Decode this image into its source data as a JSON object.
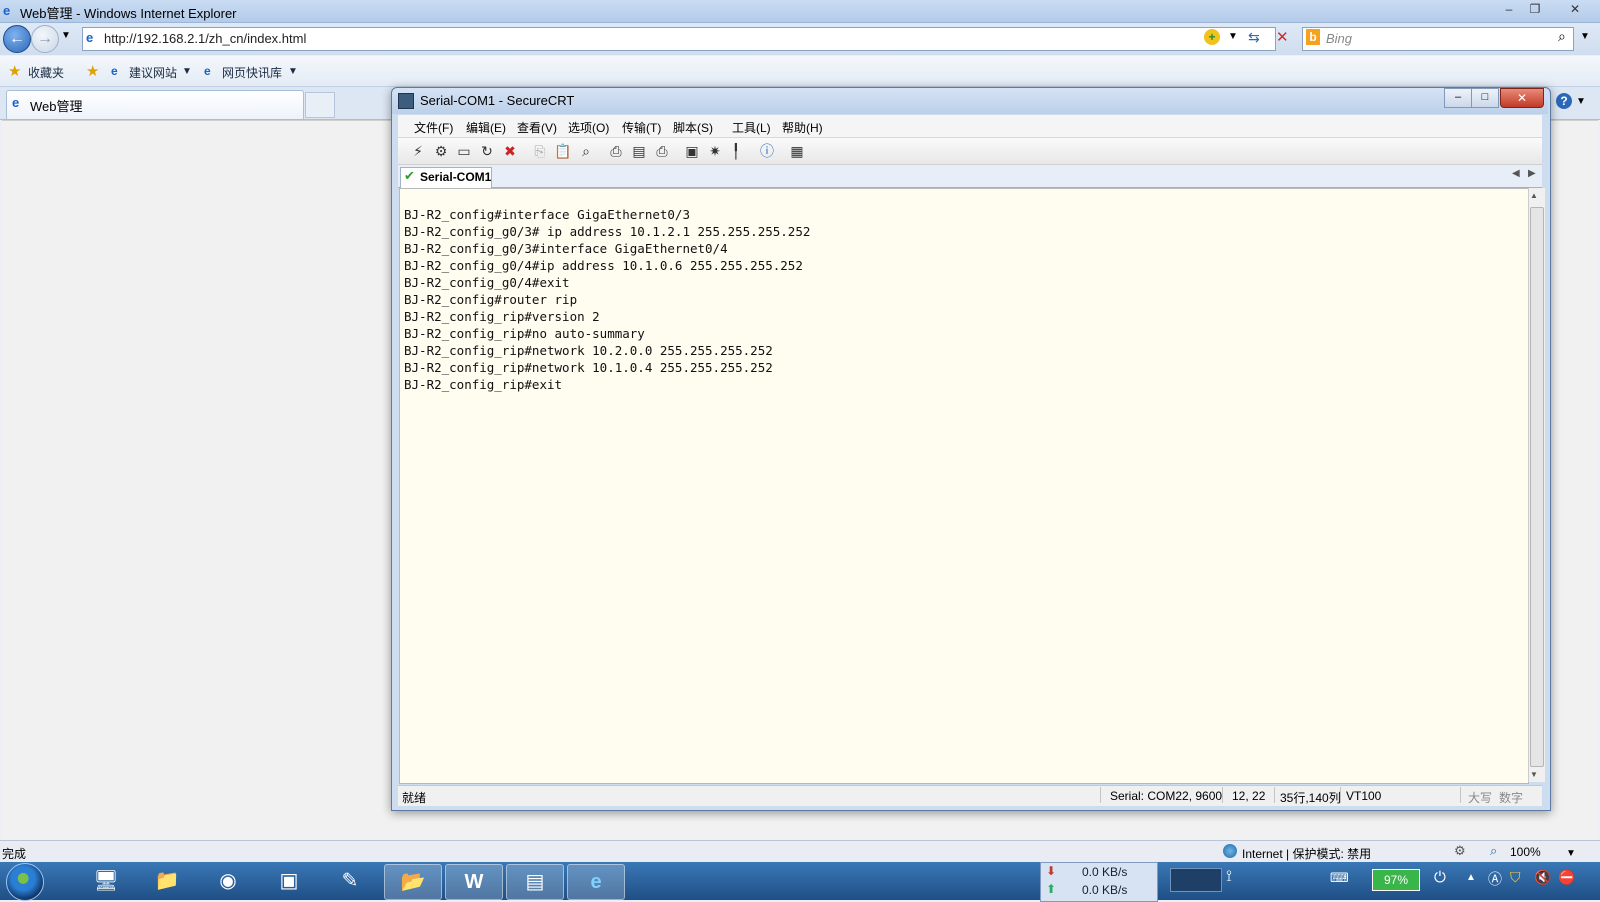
{
  "ie": {
    "window_title": "Web管理 - Windows Internet Explorer",
    "address": "http://192.168.2.1/zh_cn/index.html",
    "search_placeholder": "Bing",
    "favorites": {
      "label": "收藏夹",
      "suggested": "建议网站",
      "web_slice": "网页快讯库"
    },
    "tab_label": "Web管理",
    "status_left": "完成",
    "status_zone": "Internet | 保护模式: 禁用",
    "zoom": "100%"
  },
  "crt": {
    "title": "Serial-COM1 - SecureCRT",
    "menu": [
      "文件(F)",
      "编辑(E)",
      "查看(V)",
      "选项(O)",
      "传输(T)",
      "脚本(S)",
      "工具(L)",
      "帮助(H)"
    ],
    "tab_label": "Serial-COM1",
    "terminal_lines": [
      "BJ-R2_config#interface GigaEthernet0/3",
      "BJ-R2_config_g0/3# ip address 10.1.2.1 255.255.255.252",
      "BJ-R2_config_g0/3#interface GigaEthernet0/4",
      "BJ-R2_config_g0/4#ip address 10.1.0.6 255.255.255.252",
      "BJ-R2_config_g0/4#exit",
      "BJ-R2_config#router rip",
      "BJ-R2_config_rip#version 2",
      "BJ-R2_config_rip#no auto-summary",
      "BJ-R2_config_rip#network 10.2.0.0 255.255.255.252",
      "BJ-R2_config_rip#network 10.1.0.4 255.255.255.252",
      "BJ-R2_config_rip#exit"
    ],
    "status": {
      "state": "就绪",
      "serial": "Serial: COM22, 9600",
      "cursor": "12, 22",
      "size": "35行,140列",
      "emulation": "VT100",
      "caps": "大写",
      "num": "数字"
    }
  },
  "taskbar": {
    "download_speed": "0.0 KB/s",
    "upload_speed": "0.0 KB/s",
    "battery": "97%"
  },
  "colors": {
    "taskbar": "#1f4f86",
    "terminal_bg": "#fffcf0",
    "crt_close": "#c13a27"
  }
}
